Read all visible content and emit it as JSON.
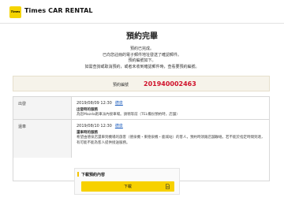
{
  "header": {
    "logo_text": "Times CAR RENTAL",
    "brand": "Times CAR RENTAL"
  },
  "title": "預約完畢",
  "message": [
    "預約已完成。",
    "已向您註冊的電子郵件地址發送了確認郵件。",
    "預約編號如下。",
    "如需查詢或取消預約，或者未收到確認郵件時，查看要預約編號。"
  ],
  "reservation": {
    "label": "預約編號",
    "number": "201940002463"
  },
  "departure": {
    "label": "出發",
    "datetime": "2019/08/09 12:30",
    "link": "德泉",
    "sub_title": "出發時的服務",
    "desc": "為您Mazda跑車派內接車場。請稍等前（TEL備份預約時，店舗）"
  },
  "return": {
    "label": "還車",
    "datetime": "2019/08/10 12:30",
    "link": "德泉",
    "sub_title": "還車時的服務",
    "desc": "希望由德泉店還車到機場的旅客（德泉機・東德泉機・鹿城站）的客人，預約時須跟店舗聯絡。若不能於指定時間到達，有可能不能為客人提供接送服務。"
  },
  "download": {
    "title": "下載預約內容",
    "button_label": "下載"
  },
  "colors": {
    "accent_yellow": "#f7d100",
    "reservation_red": "#d0112b",
    "link_blue": "#1f5fbf"
  }
}
